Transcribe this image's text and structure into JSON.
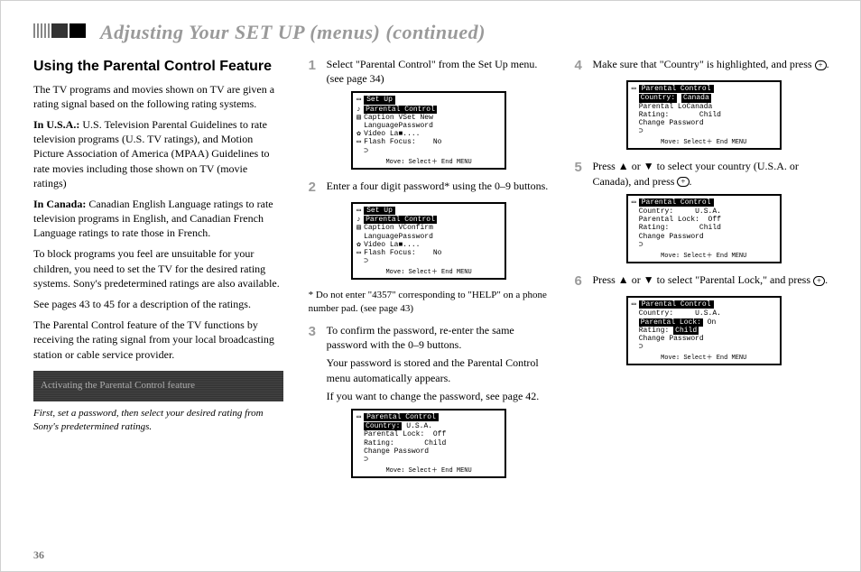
{
  "header_title": "Adjusting Your SET UP (menus) (continued)",
  "col1": {
    "heading": "Using the Parental Control Feature",
    "p1": "The TV programs and movies shown on TV are given a rating signal based on the following rating systems.",
    "p2a": "In U.S.A.:",
    "p2b": " U.S. Television Parental Guidelines to rate television programs (U.S. TV ratings), and Motion Picture Association of America (MPAA) Guidelines to rate movies including those shown on TV (movie ratings)",
    "p3a": "In Canada:",
    "p3b": " Canadian English Language ratings to rate television programs in English, and Canadian French Language ratings to rate those in French.",
    "p4": "To block programs you feel are unsuitable for your children, you need to set the TV for the desired rating systems. Sony's predetermined ratings are also available.",
    "p5": "See pages 43 to 45 for a description of the ratings.",
    "p6": "The Parental Control feature of the TV functions by receiving the rating signal from your local broadcasting station or cable service provider.",
    "shaded": "Activating the Parental Control feature",
    "caption": "First, set a password, then select your desired rating from Sony's predetermined ratings."
  },
  "steps": {
    "s1": "Select \"Parental Control\" from the Set Up menu. (see page 34)",
    "s2": "Enter a four digit password* using the 0–9 buttons.",
    "s2note": "* Do not enter \"4357\" corresponding to \"HELP\" on a phone number pad. (see page 43)",
    "s3a": "To confirm the password, re-enter the same password with the 0–9 buttons.",
    "s3b": "Your password is stored and the Parental Control menu automatically appears.",
    "s3c": "If you want to change the password, see page 42.",
    "s4a": "Make sure that \"Country\" is highlighted, and press ",
    "s4b": ".",
    "s5a": "Press ",
    "s5b": " or ",
    "s5c": " to select your country (U.S.A. or Canada), and press ",
    "s5d": ".",
    "s6a": "Press ",
    "s6b": " or ",
    "s6c": " to select \"Parental Lock,\" and press ",
    "s6d": "."
  },
  "osd": {
    "footer": "Move↕  Select＋  End  MENU",
    "m1": {
      "hdr": "Set Up",
      "hl": "Parental Control",
      "l1": "Caption VSet New",
      "l2": "LanguagePassword",
      "l3": "Video La■....",
      "l4": "Flash Focus:    No",
      "ret": "⊃"
    },
    "m2": {
      "hdr": "Set Up",
      "hl": "Parental Control",
      "l1": "Caption VConfirm",
      "l2": "LanguagePassword",
      "l3": "Video La■....",
      "l4": "Flash Focus:    No",
      "ret": "⊃"
    },
    "m3": {
      "hdr": "Parental Control",
      "hlL": "Country:",
      "hlR": "U.S.A.",
      "l1": "Parental Lock:  Off",
      "l2": "Rating:       Child",
      "l3": "Change Password",
      "ret": "⊃"
    },
    "m4": {
      "hdr": "Parental Control",
      "hlL": "Country:",
      "hlR": "Canada",
      "l1": "Parental LoCanada",
      "l2": "Rating:       Child",
      "l3": "Change Password",
      "ret": "⊃"
    },
    "m5": {
      "hdr": "Parental Control",
      "l0": "Country:     U.S.A.",
      "l1": "Parental Lock:  Off",
      "l2": "Rating:       Child",
      "l3": "Change Password",
      "ret": "⊃"
    },
    "m6": {
      "hdr": "Parental Control",
      "l0": "Country:     U.S.A.",
      "hlL": "Parental Lock:",
      "hlR": "On",
      "l2L": "Rating:",
      "l2R": "Child",
      "l3": "Change Password",
      "ret": "⊃"
    }
  },
  "btn_plus": "+",
  "arrow_up": "▲",
  "arrow_dn": "▼",
  "page_no": "36"
}
